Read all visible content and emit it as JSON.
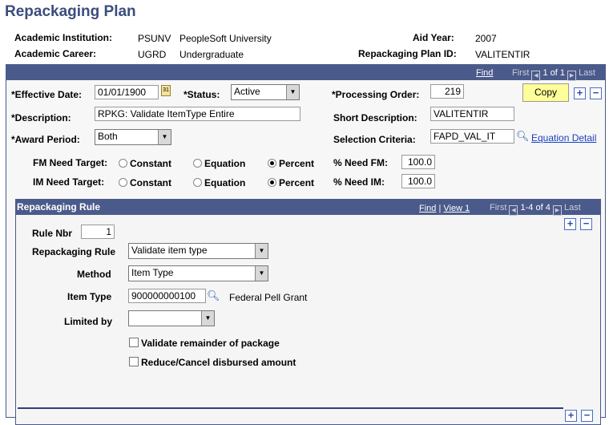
{
  "title": "Repackaging Plan",
  "header": {
    "inst_label": "Academic Institution:",
    "inst_code": "PSUNV",
    "inst_name": "PeopleSoft University",
    "career_label": "Academic Career:",
    "career_code": "UGRD",
    "career_name": "Undergraduate",
    "aid_year_label": "Aid Year:",
    "aid_year": "2007",
    "plan_id_label": "Repackaging Plan ID:",
    "plan_id": "VALITENTIR"
  },
  "nav": {
    "find": "Find",
    "first": "First",
    "count": "1 of 1",
    "last": "Last"
  },
  "form": {
    "eff_date_label": "*Effective Date:",
    "eff_date": "01/01/1900",
    "status_label": "*Status:",
    "status": "Active",
    "proc_label": "*Processing Order:",
    "proc": "219",
    "copy": "Copy",
    "desc_label": "*Description:",
    "desc": "RPKG: Validate ItemType Entire",
    "short_label": "Short Description:",
    "short": "VALITENTIR",
    "award_label": "*Award Period:",
    "award": "Both",
    "sel_label": "Selection Criteria:",
    "sel": "FAPD_VAL_IT",
    "eq_detail": "Equation Detail",
    "fm_label": "FM Need Target:",
    "im_label": "IM Need Target:",
    "opt_constant": "Constant",
    "opt_equation": "Equation",
    "opt_percent": "Percent",
    "fm_selected": "Percent",
    "im_selected": "Percent",
    "pct_fm_label": "% Need FM:",
    "pct_fm": "100.0",
    "pct_im_label": "% Need IM:",
    "pct_im": "100.0"
  },
  "rule": {
    "title": "Repackaging Rule",
    "find": "Find",
    "view": "View 1",
    "first": "First",
    "count": "1-4 of 4",
    "last": "Last",
    "nbr_label": "Rule Nbr",
    "nbr": "1",
    "rule_label": "Repackaging Rule",
    "rule": "Validate item type",
    "method_label": "Method",
    "method": "Item Type",
    "item_label": "Item Type",
    "item": "900000000100",
    "item_desc": "Federal Pell Grant",
    "limited_label": "Limited by",
    "limited": "",
    "chk1": "Validate remainder of package",
    "chk1_checked": false,
    "chk2": "Reduce/Cancel disbursed amount",
    "chk2_checked": false
  },
  "colors": {
    "bar": "#4a5a8a",
    "title": "#3b4d7c",
    "copy": "#ffff99",
    "link": "#1a3fc0"
  }
}
